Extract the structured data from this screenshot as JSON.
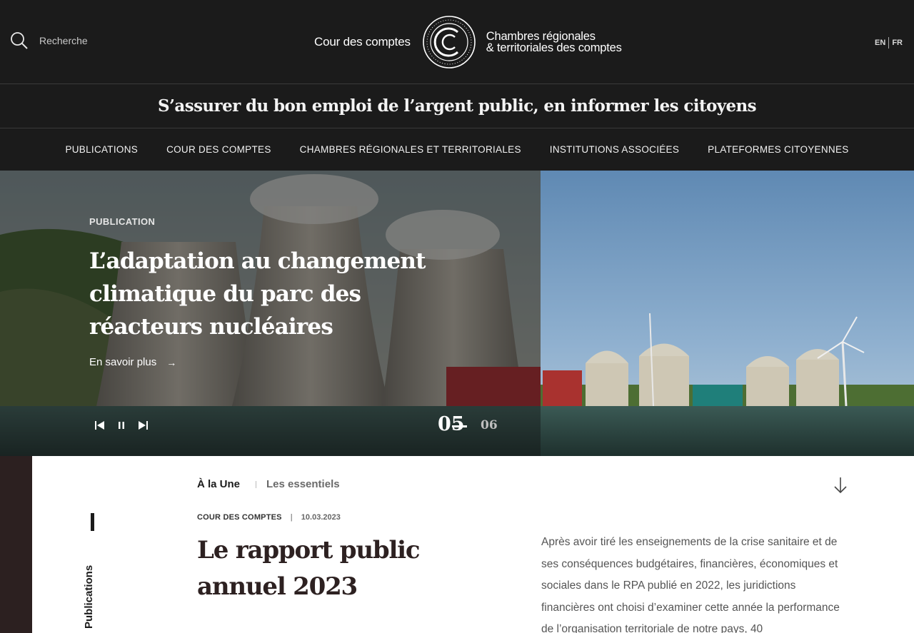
{
  "header": {
    "search_placeholder": "Recherche",
    "brand_left": "Cour des comptes",
    "brand_seal_text": "CC",
    "brand_right_line1": "Chambres régionales",
    "brand_right_line2": "& territoriales des comptes",
    "lang_en": "EN",
    "lang_fr": "FR"
  },
  "tagline": "S’assurer du bon emploi de l’argent public, en informer les citoyens",
  "nav": {
    "items": [
      "PUBLICATIONS",
      "COUR DES COMPTES",
      "CHAMBRES RÉGIONALES ET TERRITORIALES",
      "INSTITUTIONS ASSOCIÉES",
      "PLATEFORMES CITOYENNES"
    ]
  },
  "hero": {
    "category": "PUBLICATION",
    "title": "L’adaptation au changement climatique du parc des réacteurs nucléaires",
    "link": "En savoir plus",
    "link_icon": "arrow-right-icon",
    "current_slide": "05",
    "next_slide": "06"
  },
  "section": {
    "vertical_label": "Publications",
    "tab_active": "À la Une",
    "tab_inactive": "Les essentiels",
    "article": {
      "category": "COUR DES COMPTES",
      "date": "10.03.2023",
      "title": "Le rapport public annuel 2023",
      "text": "Après avoir tiré les enseignements de la crise sanitaire et de ses conséquences budgétaires, financières, économiques et sociales dans le RPA publié en 2022, les juridictions financières ont choisi d’examiner cette année la performance de l’organisation territoriale de notre pays, 40"
    }
  },
  "colors": {
    "header_bg": "#1b1b1b",
    "side_panel": "#2c2020",
    "title_text": "#2d2121"
  }
}
